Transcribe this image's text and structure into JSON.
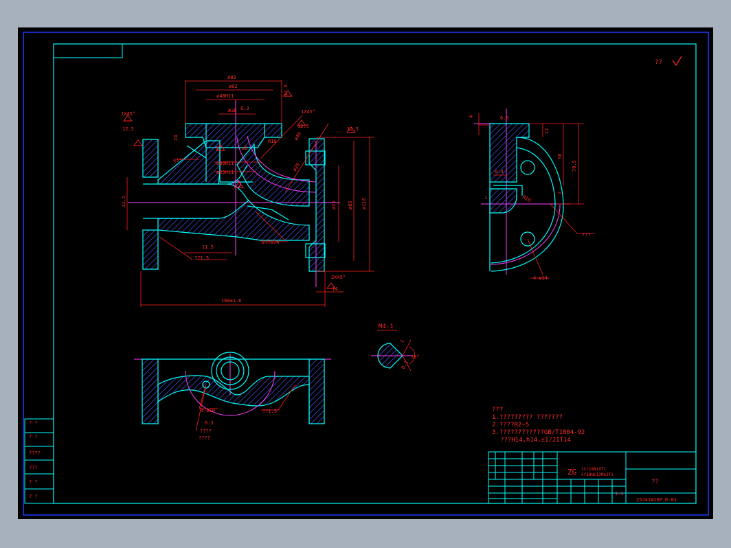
{
  "drawing": {
    "corner_mark": "??",
    "detail_label": "M4:1",
    "notes": {
      "heading": "???",
      "line1": "1.????????? ???????",
      "line2": "2.????R2~5",
      "line3": "3.????????????GB/T1804-92",
      "line4": "???H14,h14,±1/2IT14"
    },
    "material": {
      "prefix": "ZG",
      "line1": "1Cr18Ni9Ti",
      "line2": "Cr18Ni12Mo2Ti"
    },
    "title_block": {
      "name": "??",
      "code": "25J41W16P.R-01",
      "scale": "1:1"
    },
    "left_strip": [
      "?  ?",
      "?  ?",
      "????",
      "???",
      "?  ?",
      "?  ?"
    ],
    "dims_front": {
      "d82": "ø82",
      "d62": "ø62",
      "d48h11": "ø48H11",
      "d38": "ø38",
      "ang45": "45°",
      "d30h11": "ø30H11",
      "d25h11": "ø25H11",
      "d8": "ø8",
      "r10": "R10",
      "d28": "ø28",
      "d40": "ø40",
      "d25": "ø25",
      "d85": "ø85",
      "d118": "ø118",
      "len160": "160±1.6",
      "d14": "14",
      "cham1": "1X45°",
      "cham2": "1X45°",
      "cham3": "2X45°",
      "r125a": "12.5",
      "r125b": "12.5",
      "r125c": "12.5",
      "r125d": "12.5",
      "d115": "11.5",
      "r15": "??1.5",
      "cast": "2??674",
      "d24": "24",
      "d7": "7",
      "d6_3": "6.3",
      "d12_5top": "12.5"
    },
    "dims_side": {
      "d6_3": "6.3",
      "d4": "4",
      "d12": "12",
      "d50": "50",
      "d70_5": "70.5",
      "r10": "R10",
      "d2": "2",
      "d1": "1",
      "holes": "4-ø14",
      "callout": "???",
      "d04": "0.4"
    },
    "dims_plan": {
      "holes": "4-ø10",
      "d63": "6.3",
      "notes": "????",
      "notes2": "????",
      "r15": "??1.5"
    },
    "dims_detail": {
      "ang": "30°",
      "d1": "1",
      "d2": "0.1"
    },
    "colors": {
      "background": "#000000",
      "border": "#00ffff",
      "outline": "#00ffff",
      "hatch": "#4a5cff",
      "dimension": "#ff2020",
      "center": "#ff40ff",
      "text_red": "#ff2a2a"
    }
  }
}
